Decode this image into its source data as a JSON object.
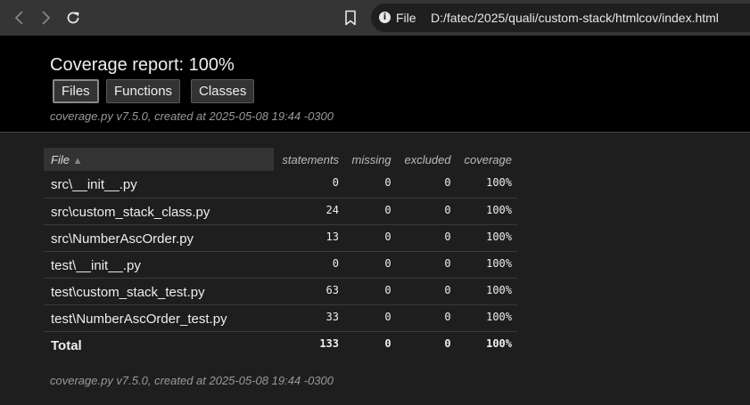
{
  "browser": {
    "scheme_label": "File",
    "url": "D:/fatec/2025/quali/custom-stack/htmlcov/index.html"
  },
  "header": {
    "title": "Coverage report: 100%",
    "tabs": [
      {
        "label": "Files",
        "active": true
      },
      {
        "label": "Functions",
        "active": false
      },
      {
        "label": "Classes",
        "active": false
      }
    ],
    "created": "coverage.py v7.5.0, created at 2025-05-08 19:44 -0300"
  },
  "table": {
    "columns": [
      "File",
      "statements",
      "missing",
      "excluded",
      "coverage"
    ],
    "sort_indicator": "▲",
    "rows": [
      {
        "file": "src\\__init__.py",
        "statements": "0",
        "missing": "0",
        "excluded": "0",
        "coverage": "100%"
      },
      {
        "file": "src\\custom_stack_class.py",
        "statements": "24",
        "missing": "0",
        "excluded": "0",
        "coverage": "100%"
      },
      {
        "file": "src\\NumberAscOrder.py",
        "statements": "13",
        "missing": "0",
        "excluded": "0",
        "coverage": "100%"
      },
      {
        "file": "test\\__init__.py",
        "statements": "0",
        "missing": "0",
        "excluded": "0",
        "coverage": "100%"
      },
      {
        "file": "test\\custom_stack_test.py",
        "statements": "63",
        "missing": "0",
        "excluded": "0",
        "coverage": "100%"
      },
      {
        "file": "test\\NumberAscOrder_test.py",
        "statements": "33",
        "missing": "0",
        "excluded": "0",
        "coverage": "100%"
      }
    ],
    "total": {
      "file": "Total",
      "statements": "133",
      "missing": "0",
      "excluded": "0",
      "coverage": "100%"
    }
  },
  "footer": {
    "created": "coverage.py v7.5.0, created at 2025-05-08 19:44 -0300"
  },
  "icons": {
    "back": "chevron-left-icon",
    "forward": "chevron-right-icon",
    "reload": "reload-icon",
    "bookmark": "bookmark-icon",
    "info": "info-icon"
  },
  "colors": {
    "browser_toolbar": "#353535",
    "address_bar": "#1f1f1f",
    "header_bg": "#000000",
    "page_bg": "#1e1e1e",
    "header_cell_bg": "#333333"
  }
}
